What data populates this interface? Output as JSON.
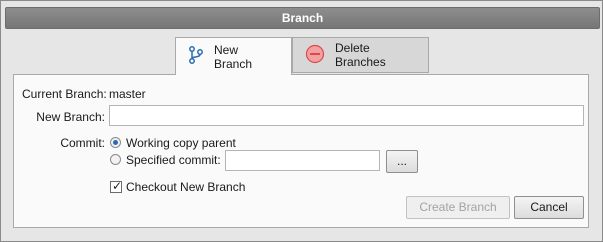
{
  "dialog": {
    "title": "Branch"
  },
  "tabs": [
    {
      "label": "New Branch",
      "icon": "branch-icon",
      "selected": true
    },
    {
      "label": "Delete Branches",
      "icon": "delete-circle-icon",
      "selected": false
    }
  ],
  "form": {
    "current_branch_label": "Current Branch:",
    "current_branch_value": "master",
    "new_branch_label": "New Branch:",
    "new_branch_value": "",
    "commit_label": "Commit:",
    "commit_options": [
      {
        "label": "Working copy parent",
        "checked": true
      },
      {
        "label": "Specified commit:",
        "checked": false
      }
    ],
    "specified_commit_value": "",
    "browse_label": "...",
    "checkout_label": "Checkout New Branch",
    "checkout_checked": true
  },
  "buttons": {
    "create_label": "Create Branch",
    "create_enabled": false,
    "cancel_label": "Cancel"
  },
  "colors": {
    "accent": "#2b6cb0",
    "delete_icon_fill": "#f2a0a0",
    "delete_icon_stroke": "#d94a4a"
  }
}
